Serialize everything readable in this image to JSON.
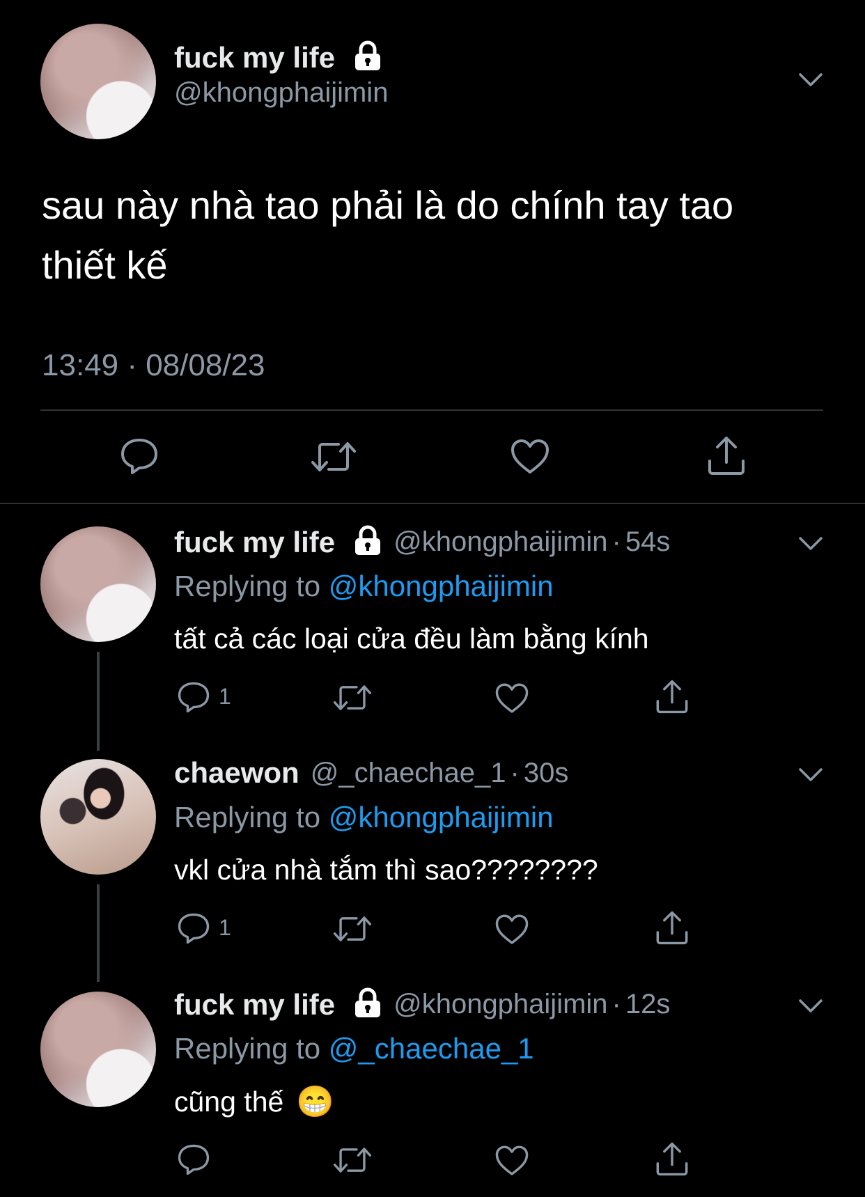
{
  "main_tweet": {
    "display_name": "fuck my life",
    "handle": "@khongphaijimin",
    "text": "sau này nhà tao phải là do chính tay tao thiết kế",
    "timestamp": "13:49 · 08/08/23",
    "icons": [
      "lock-icon",
      "chevron-down-icon",
      "reply-icon",
      "retweet-icon",
      "like-icon",
      "share-icon"
    ]
  },
  "replies": [
    {
      "display_name": "fuck my life",
      "handle": "@khongphaijimin",
      "sep": "·",
      "time": "54s",
      "replying_label": "Replying to",
      "replying_to": "@khongphaijimin",
      "text": "tất cả các loại cửa đều làm bằng kính",
      "reply_count": "1"
    },
    {
      "display_name": "chaewon",
      "handle": "@_chaechae_1",
      "sep": "·",
      "time": "30s",
      "replying_label": "Replying to",
      "replying_to": "@khongphaijimin",
      "text": "vkl cửa nhà tắm thì sao????????",
      "reply_count": "1"
    },
    {
      "display_name": "fuck my life",
      "handle": "@khongphaijimin",
      "sep": "·",
      "time": "12s",
      "replying_label": "Replying to",
      "replying_to": "@_chaechae_1",
      "text": "cũng thế",
      "emoji": "😁",
      "reply_count": ""
    }
  ],
  "colors": {
    "background": "#000000",
    "link": "#1d9bf0",
    "muted": "#8b98a5",
    "text": "#ffffff",
    "divider": "#2f3336"
  }
}
